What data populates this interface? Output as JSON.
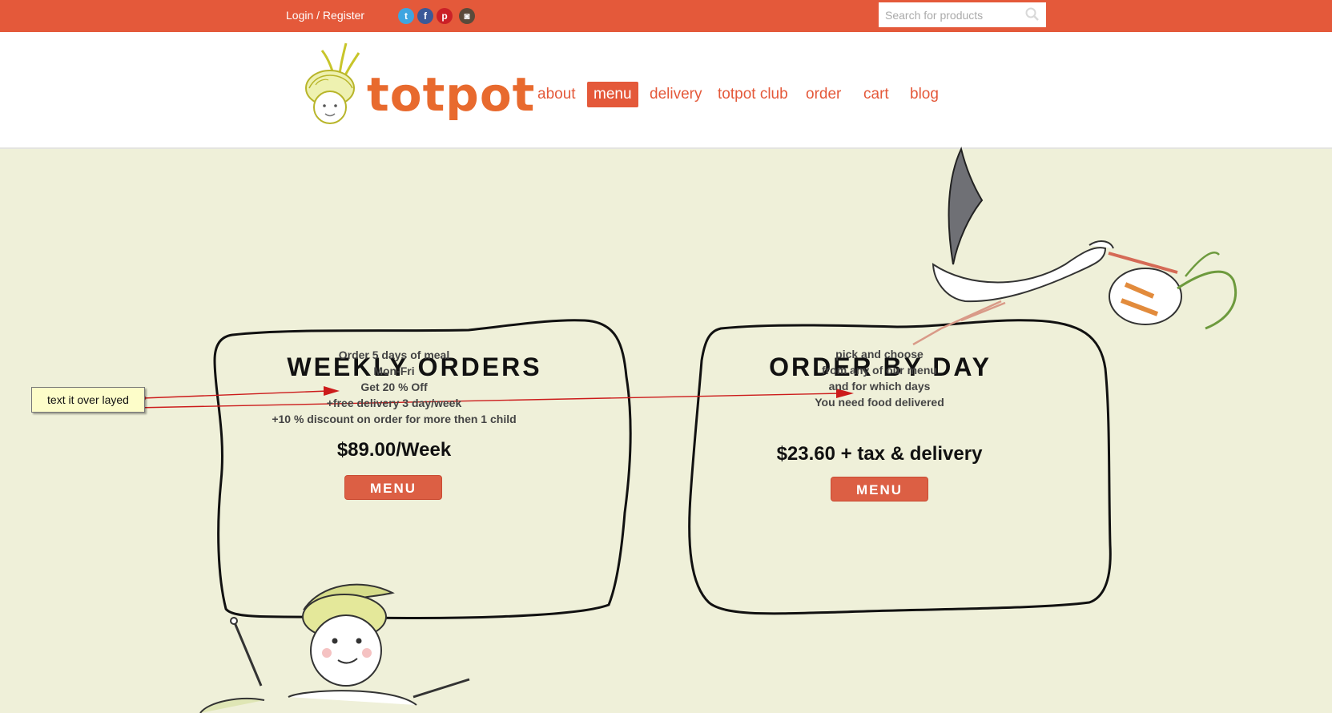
{
  "topbar": {
    "login_label": "Login / Register",
    "social": [
      {
        "name": "twitter-icon",
        "glyph": "t",
        "color": "#3ea5e0"
      },
      {
        "name": "facebook-icon",
        "glyph": "f",
        "color": "#3b5998"
      },
      {
        "name": "pinterest-icon",
        "glyph": "p",
        "color": "#cb2027"
      },
      {
        "name": "instagram-icon",
        "glyph": "◙",
        "color": "#5a4a3a"
      }
    ],
    "search_placeholder": "Search for products"
  },
  "header": {
    "logo_text": "totpot",
    "nav": [
      "about",
      "menu",
      "delivery",
      "totpot club",
      "order",
      "cart",
      "blog"
    ],
    "active_nav": "menu"
  },
  "cards": {
    "weekly": {
      "title": "WEEKLY ORDERS",
      "lines": [
        "Order 5 days of meal",
        "Mon-Fri",
        "Get 20 % Off",
        "+free delivery 3 day/week",
        "+10 % discount on order for more then 1 child"
      ],
      "price": "$89.00/Week",
      "button": "MENU"
    },
    "byday": {
      "title": "ORDER BY DAY",
      "lines": [
        "pick and choose",
        "from any of our menu",
        "and for which days",
        "You need food delivered"
      ],
      "price": "$23.60 + tax & delivery",
      "button": "MENU"
    }
  },
  "annotation": {
    "note": "text it over layed"
  },
  "colors": {
    "brand": "#e4593a",
    "background": "#eff0d9",
    "button": "#dc5f44"
  }
}
